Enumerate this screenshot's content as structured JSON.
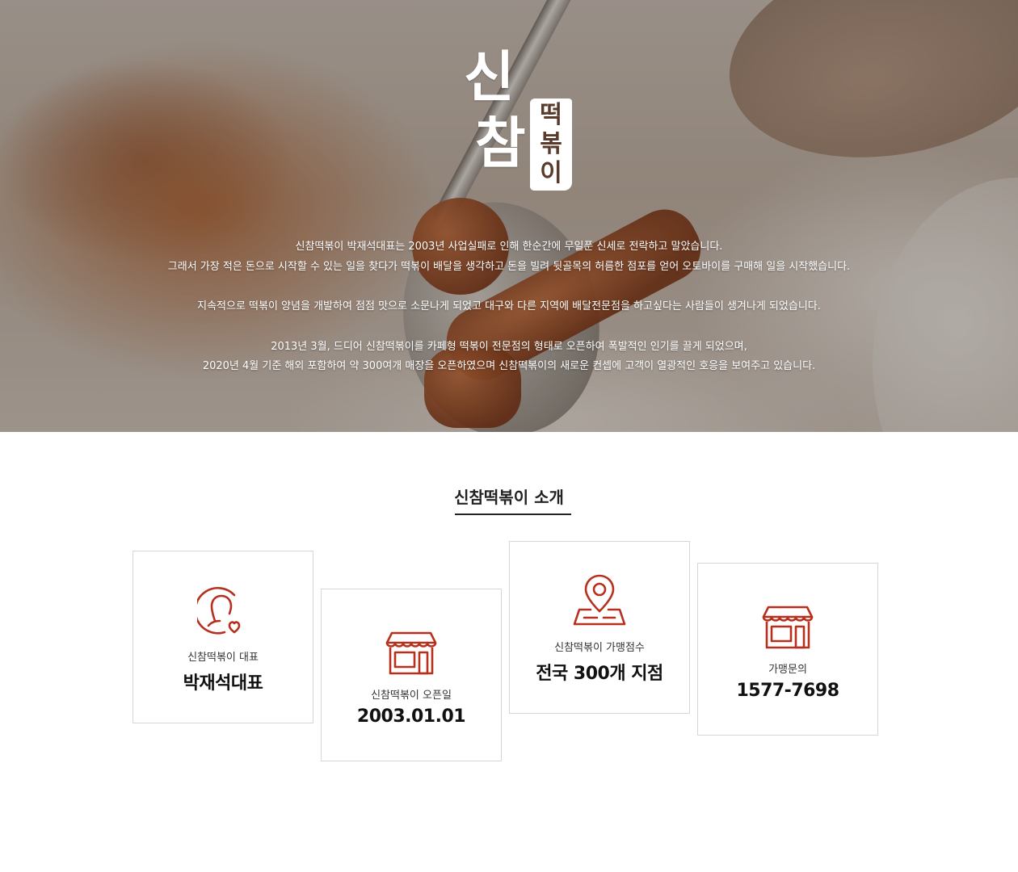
{
  "hero": {
    "logo": {
      "big_chars": [
        "신",
        "참"
      ],
      "sub_chars": [
        "떡",
        "볶",
        "이"
      ]
    },
    "paragraphs": [
      [
        "신참떡볶이 박재석대표는 2003년 사업실패로 인해 한순간에 무일푼 신세로 전락하고 말았습니다.",
        "그래서 가장 적은 돈으로 시작할 수 있는 일을 찾다가 떡볶이 배달을 생각하고 돈을 빌려 뒷골목의 허름한 점포를 얻어 오토바이를 구매해 일을 시작했습니다."
      ],
      [
        "지속적으로 떡볶이 양념을 개발하여 점점 맛으로 소문나게 되었고 대구와 다른 지역에 배달전문점을 하고싶다는 사람들이 생겨나게 되었습니다."
      ],
      [
        "2013년 3월, 드디어 신참떡볶이를 카페형 떡볶이 전문점의 형태로 오픈하여 폭발적인 인기를 끌게 되었으며,",
        "2020년 4월 기준 해외 포함하여 약 300여개 매장을 오픈하였으며 신참떡볶이의 새로운 컨셉에 고객이 열광적인 호응을 보여주고 있습니다."
      ]
    ]
  },
  "intro": {
    "title": "신참떡볶이 소개",
    "accent_color": "#b6301e",
    "cards": [
      {
        "icon": "person-heart-icon",
        "label": "신참떡볶이 대표",
        "value": "박재석대표"
      },
      {
        "icon": "storefront-icon",
        "label": "신참떡볶이 오픈일",
        "value": "2003.01.01"
      },
      {
        "icon": "map-pin-icon",
        "label": "신참떡볶이 가맹점수",
        "value": "전국 300개 지점"
      },
      {
        "icon": "storefront-icon",
        "label": "가맹문의",
        "value": "1577-7698"
      }
    ]
  }
}
